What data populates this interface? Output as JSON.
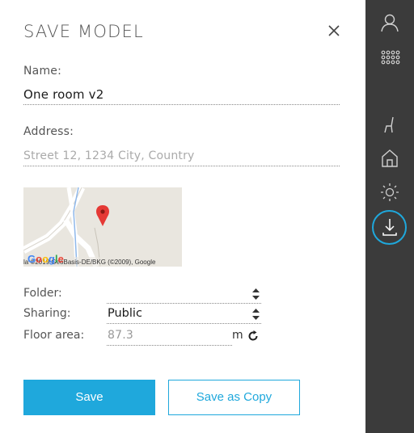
{
  "dialog": {
    "title": "SAVE MODEL",
    "close_icon": "close-icon"
  },
  "form": {
    "name_label": "Name:",
    "name_value": "One room v2",
    "address_label": "Address:",
    "address_placeholder": "Street 12, 1234 City, Country",
    "folder_label": "Folder:",
    "folder_value": "",
    "sharing_label": "Sharing:",
    "sharing_value": "Public",
    "floor_area_label": "Floor area:",
    "floor_area_value": "87.3",
    "floor_area_unit": "m"
  },
  "map": {
    "logo": "Google",
    "attribution": "la ©2019 GeoBasis-DE/BKG (©2009), Google"
  },
  "buttons": {
    "save": "Save",
    "save_as_copy": "Save as Copy"
  },
  "sidebar": {
    "items": [
      {
        "icon": "user-icon"
      },
      {
        "icon": "apps-grid-icon"
      },
      {
        "icon": "chair-icon"
      },
      {
        "icon": "house-icon"
      },
      {
        "icon": "sun-icon"
      },
      {
        "icon": "download-icon",
        "active": true
      }
    ]
  },
  "colors": {
    "accent": "#1fa8dc",
    "sidebar_bg": "#3b3b3b"
  }
}
